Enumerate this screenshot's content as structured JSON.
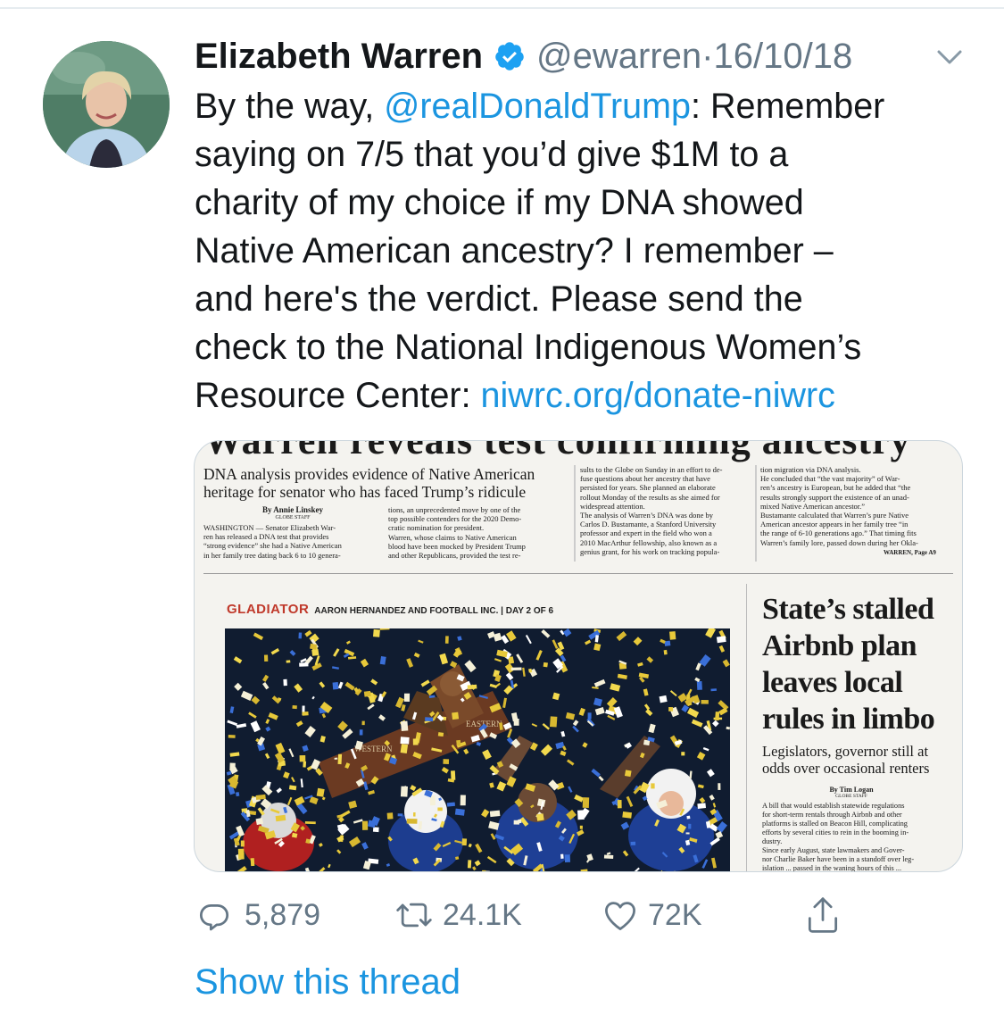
{
  "tweet": {
    "author_name": "Elizabeth Warren",
    "handle": "@ewarren",
    "separator": " · ",
    "date": "16/10/18",
    "text_lines": [
      {
        "pre": "By the way, ",
        "link": "@realDonaldTrump",
        "post": ": Remember"
      },
      {
        "pre": "saying on 7/5 that you’d give $1M to a",
        "link": "",
        "post": ""
      },
      {
        "pre": "charity of my choice if my DNA showed",
        "link": "",
        "post": ""
      },
      {
        "pre": "Native American ancestry? I remember –",
        "link": "",
        "post": ""
      },
      {
        "pre": "and here's the verdict. Please send the",
        "link": "",
        "post": ""
      },
      {
        "pre": "check to the National Indigenous Women’s",
        "link": "",
        "post": ""
      },
      {
        "pre": "Resource Center: ",
        "link": "niwrc.org/donate-niwrc",
        "post": ""
      }
    ]
  },
  "newspaper": {
    "top_headline_fragment": "Warren reveals test confirming ancestry",
    "deck_line1": "DNA analysis provides evidence of Native American",
    "deck_line2": "heritage for senator who has faced Trump’s ridicule",
    "byline": "By Annie Linskey",
    "byline_staff": "GLOBE STAFF",
    "col1": [
      "WASHINGTON — Senator Elizabeth War-",
      "ren has released a DNA test that provides",
      "“strong evidence” she had a Native American",
      "in her family tree dating back 6 to 10 genera-"
    ],
    "col2": [
      "tions, an unprecedented move by one of the",
      "top possible contenders for the 2020 Demo-",
      "cratic nomination for president.",
      "Warren, whose claims to Native American",
      "blood have been mocked by President Trump",
      "and other Republicans, provided the test re-"
    ],
    "col3": [
      "sults to the Globe on Sunday in an effort to de-",
      "fuse questions about her ancestry that have",
      "persisted for years. She planned an elaborate",
      "rollout Monday of the results as she aimed for",
      "widespread attention.",
      "The analysis of Warren’s DNA was done by",
      "Carlos D. Bustamante, a Stanford University",
      "professor and expert in the field who won a",
      "2010 MacArthur fellowship, also known as a",
      "genius grant, for his work on tracking popula-"
    ],
    "col4": [
      "tion migration via DNA analysis.",
      "He concluded that “the vast majority” of War-",
      "ren’s ancestry is European, but he added that “the",
      "results strongly support the existence of an unad-",
      "mixed Native American ancestor.”",
      "Bustamante calculated that Warren’s pure Native",
      "American ancestor appears in her family tree “in",
      "the range of 6-10 generations ago.” That timing fits",
      "Warren’s family lore, passed down during her Okla-"
    ],
    "jump": "WARREN, Page A9",
    "gladiator_kicker": "GLADIATOR",
    "gladiator_title": "AARON HERNANDEZ AND FOOTBALL INC. | DAY 2 OF 6",
    "plaque_left": "WESTERN",
    "plaque_right": "EASTERN",
    "side_headline": [
      "State’s stalled",
      "Airbnb plan",
      "leaves local",
      "rules in limbo"
    ],
    "side_deck": [
      "Legislators, governor still at",
      "odds over occasional renters"
    ],
    "side_byline": "By Tim Logan",
    "side_staff": "GLOBE STAFF",
    "side_body": [
      "A bill that would establish statewide regulations",
      "for short-term rentals through Airbnb and other",
      "platforms is stalled on Beacon Hill, complicating",
      "efforts by several cities to rein in the booming in-",
      "dustry.",
      "Since early August, state lawmakers and Gover-",
      "nor Charlie Baker have been in a standoff over leg-",
      "islation ... passed in the waning hours of this ..."
    ]
  },
  "actions": {
    "replies": "5,879",
    "retweets": "24.1K",
    "likes": "72K"
  },
  "show_thread": "Show this thread",
  "colors": {
    "link": "#1b95e0",
    "verified": "#1da1f2",
    "muted": "#657786",
    "gladiator_red": "#c0392b"
  },
  "icons": [
    "verified-badge-icon",
    "chevron-down-icon",
    "reply-icon",
    "retweet-icon",
    "like-icon",
    "share-icon"
  ]
}
